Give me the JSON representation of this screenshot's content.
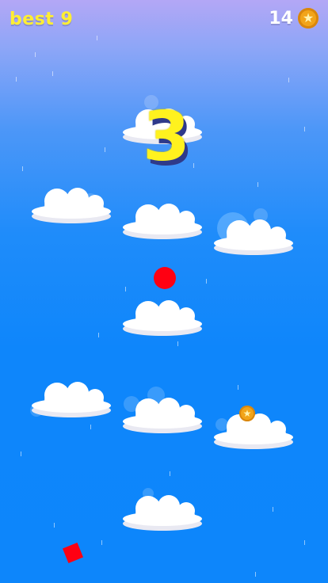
{
  "hud": {
    "best_label": "best 9",
    "coin_count": "14"
  },
  "countdown": "3",
  "icons": {
    "coin": "star-coin-icon",
    "star_glyph": "★"
  },
  "colors": {
    "score_yellow": "#ffee33",
    "countdown_yellow": "#fff21e",
    "player_red": "#ff0012",
    "coin_gold": "#f2a419",
    "sky_top": "#b3a7f6",
    "sky_bottom": "#0d86fb"
  }
}
